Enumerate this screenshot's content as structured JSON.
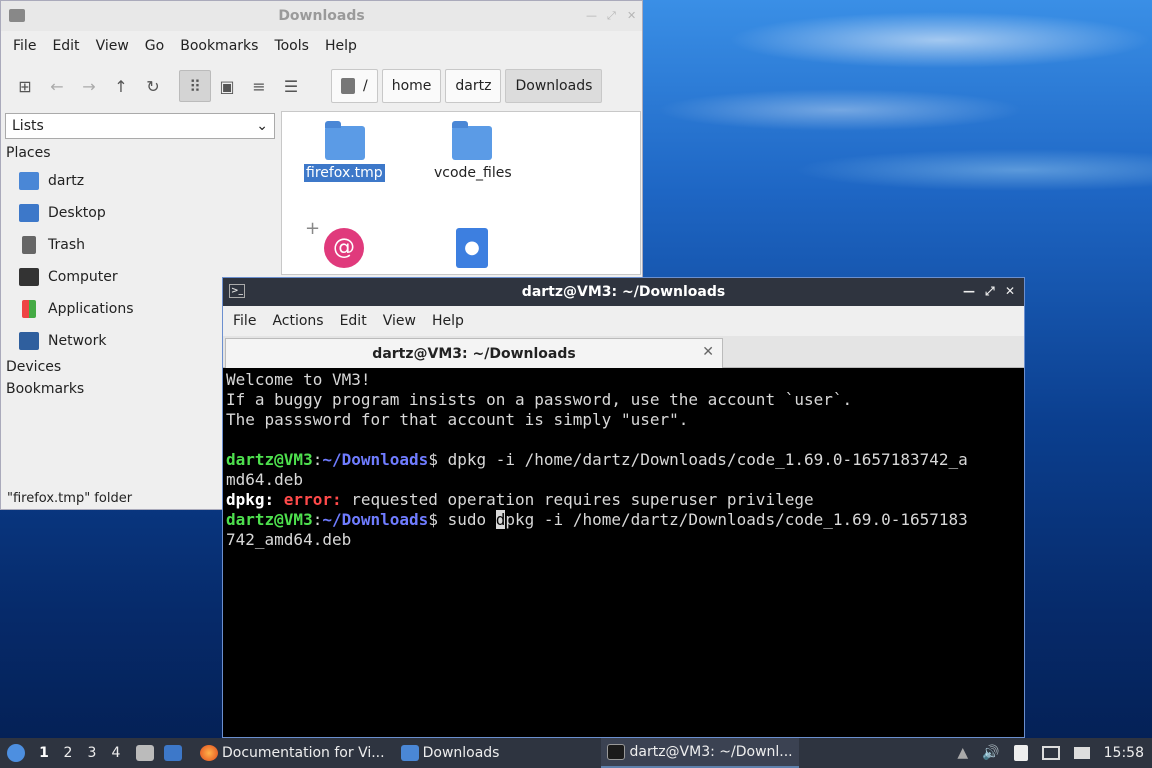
{
  "file_manager": {
    "title": "Downloads",
    "menu": [
      "File",
      "Edit",
      "View",
      "Go",
      "Bookmarks",
      "Tools",
      "Help"
    ],
    "location": [
      "/",
      "home",
      "dartz",
      "Downloads"
    ],
    "side_select": "Lists",
    "places_header": "Places",
    "places": [
      {
        "label": "dartz",
        "icon": "home-folder-icon"
      },
      {
        "label": "Desktop",
        "icon": "desktop-icon"
      },
      {
        "label": "Trash",
        "icon": "trash-icon"
      },
      {
        "label": "Computer",
        "icon": "computer-icon"
      },
      {
        "label": "Applications",
        "icon": "applications-icon"
      },
      {
        "label": "Network",
        "icon": "network-icon"
      }
    ],
    "devices_header": "Devices",
    "bookmarks_header": "Bookmarks",
    "files": [
      {
        "name": "firefox.tmp",
        "type": "folder",
        "selected": true
      },
      {
        "name": "vcode_files",
        "type": "folder",
        "selected": false
      },
      {
        "name": "",
        "type": "debian-package"
      },
      {
        "name": "",
        "type": "html-file"
      }
    ],
    "status": "\"firefox.tmp\" folder"
  },
  "terminal": {
    "title": "dartz@VM3: ~/Downloads",
    "menu": [
      "File",
      "Actions",
      "Edit",
      "View",
      "Help"
    ],
    "tab_label": "dartz@VM3: ~/Downloads",
    "lines": {
      "l1": "Welcome to VM3!",
      "l2": "If a buggy program insists on a password, use the account `user`.",
      "l3": "The passsword for that account is simply \"user\".",
      "user": "dartz@VM3",
      "sep": ":",
      "path": "~/Downloads",
      "prompt_end": "$ ",
      "cmd1": "dpkg -i /home/dartz/Downloads/code_1.69.0-1657183742_a",
      "cmd1_wrap": "md64.deb",
      "err_prog": "dpkg: ",
      "err_word": "error:",
      "err_msg": " requested operation requires superuser privilege",
      "cmd2_pre": "sudo ",
      "cmd2_cursor": "d",
      "cmd2_post": "pkg -i /home/dartz/Downloads/code_1.69.0-1657183",
      "cmd2_wrap": "742_amd64.deb"
    }
  },
  "taskbar": {
    "workspaces": [
      "1",
      "2",
      "3",
      "4"
    ],
    "tasks": [
      {
        "label": "Documentation for Vi...",
        "icon": "firefox-icon"
      },
      {
        "label": "Downloads",
        "icon": "folder-icon"
      },
      {
        "label": "dartz@VM3: ~/Downl...",
        "icon": "terminal-icon"
      }
    ],
    "clock": "15:58"
  }
}
